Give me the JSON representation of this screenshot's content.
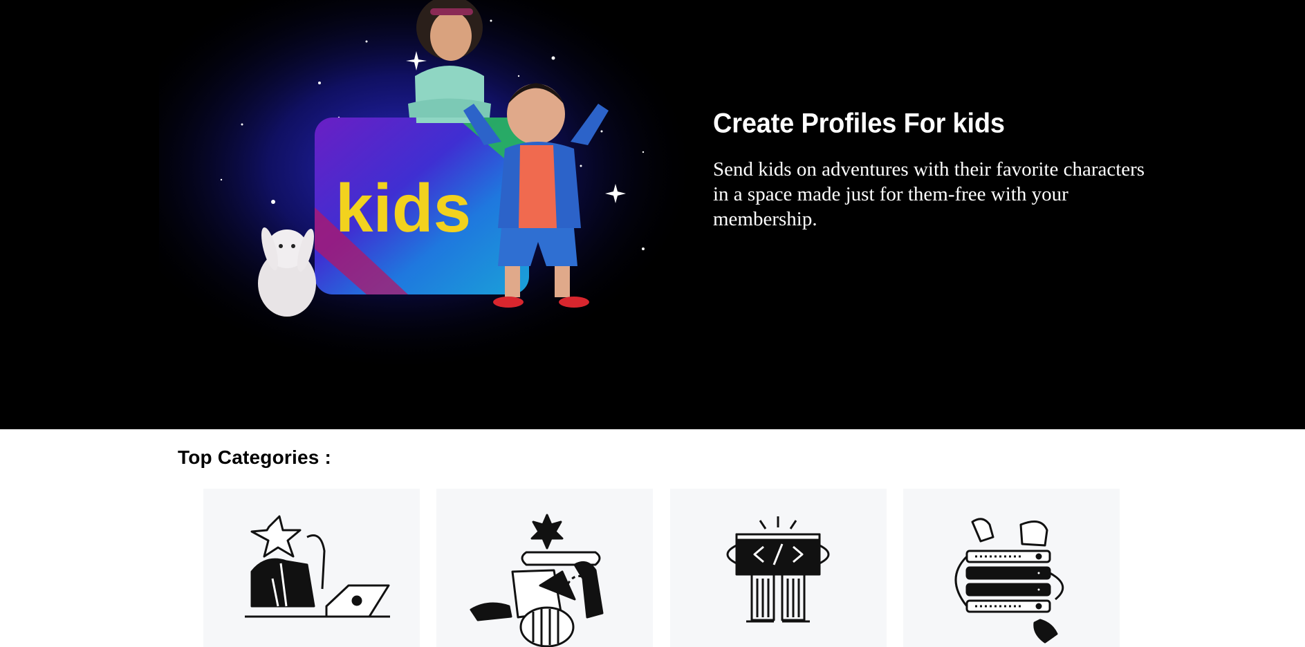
{
  "hero": {
    "title": "Create Profiles For kids",
    "description": "Send kids on adventures with their favorite characters in a space made just for them-free with your membership.",
    "logo_text": "kids",
    "colors": {
      "background": "#000000",
      "glow": "#1a1aa0",
      "logo_yellow": "#f2d21e",
      "logo_purple": "#5a1fb0",
      "logo_blue": "#1e6fd8"
    }
  },
  "categories": {
    "title": "Top Categories :",
    "cards": [
      {
        "icon": "business-star-laptop-icon"
      },
      {
        "icon": "design-shapes-icon"
      },
      {
        "icon": "code-screen-icon"
      },
      {
        "icon": "server-stack-icon"
      }
    ],
    "colors": {
      "card_bg": "#f6f7f9"
    }
  }
}
